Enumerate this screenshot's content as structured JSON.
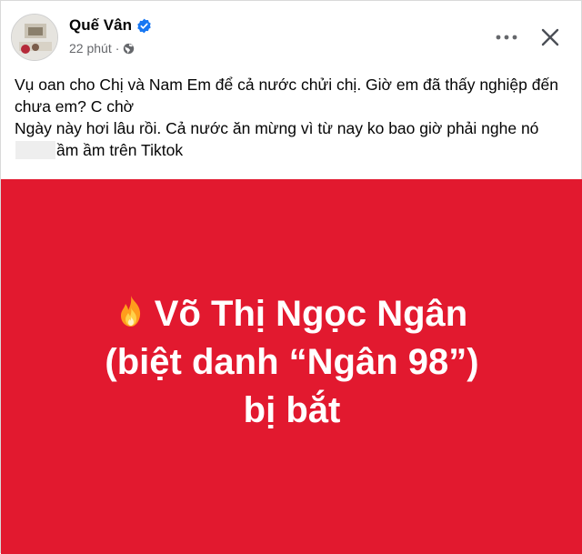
{
  "post": {
    "author": "Quế Vân",
    "verified_icon": "verified-badge-icon",
    "time": "22 phút",
    "separator": "·",
    "audience_icon": "globe-icon",
    "more_icon": "more-options-icon",
    "close_icon": "close-icon",
    "caption_line1": "Vụ oan cho Chị và Nam Em để cả nước chửi chị. Giờ em đã thấy nghiệp đến chưa em? C chờ",
    "caption_line2_start": "Ngày này hơi lâu rồi. Cả nước ăn mừng vì từ nay ko bao giờ phải nghe nó",
    "caption_line2_end": "ầm ầm trên Tiktok"
  },
  "banner": {
    "emoji_icon": "fire-icon",
    "line1": "Võ Thị Ngọc Ngân",
    "line2": "(biệt danh “Ngân 98”)",
    "line3": "bị bắt"
  },
  "colors": {
    "banner_bg": "#e2192f",
    "verified_blue": "#1877f2",
    "meta_gray": "#65676b"
  }
}
